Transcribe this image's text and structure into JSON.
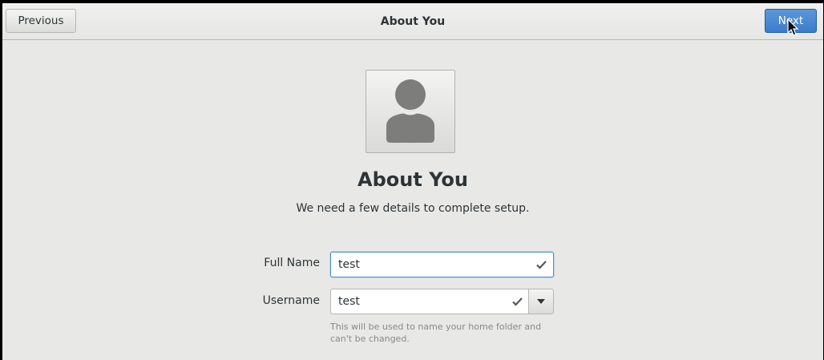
{
  "header": {
    "previous_label": "Previous",
    "title": "About You",
    "next_label": "Next"
  },
  "main": {
    "avatar_icon": "user-avatar-icon",
    "title": "About You",
    "subtitle": "We need a few details to complete setup."
  },
  "form": {
    "full_name": {
      "label": "Full Name",
      "value": "test",
      "status_icon": "check-icon"
    },
    "username": {
      "label": "Username",
      "value": "test",
      "status_icon": "check-icon",
      "dropdown_icon": "chevron-down-icon",
      "hint": "This will be used to name your home folder and can't be changed."
    }
  },
  "colors": {
    "accent": "#4a90d9",
    "next_button": "#3b7ccc",
    "background": "#e8e8e7",
    "text": "#2e3436",
    "hint_text": "#888a85"
  }
}
